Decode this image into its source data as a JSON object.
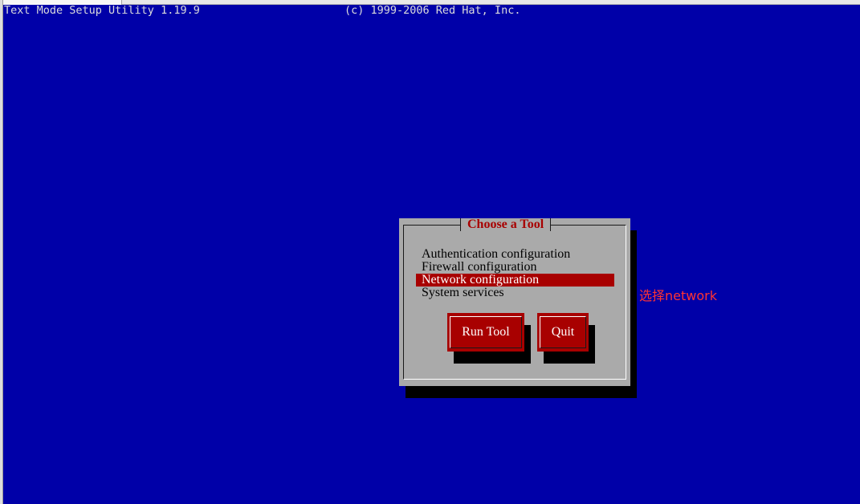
{
  "window": {
    "title_left": "Text Mode Setup Utility 1.19.9",
    "title_right": "(c) 1999-2006 Red Hat, Inc."
  },
  "dialog": {
    "title": "Choose a Tool",
    "items": [
      {
        "label": "Authentication configuration",
        "selected": false
      },
      {
        "label": "Firewall configuration",
        "selected": false
      },
      {
        "label": "Network configuration",
        "selected": true
      },
      {
        "label": "System services",
        "selected": false
      }
    ],
    "buttons": {
      "run_label": "Run Tool",
      "quit_label": "Quit"
    }
  },
  "annotation": {
    "text": "选择network"
  },
  "colors": {
    "screen_background": "#0000a8",
    "dialog_background": "#aaaaaa",
    "selection": "#a80000",
    "title_text": "#a80000",
    "annotation_text": "#ff3333"
  }
}
